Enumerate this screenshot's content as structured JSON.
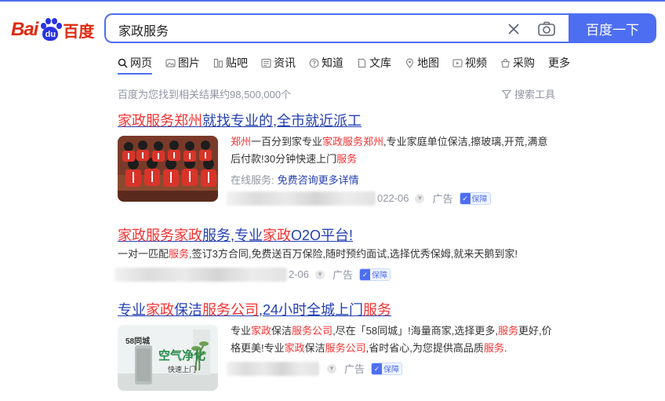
{
  "logo": {
    "latin": "Bai",
    "paw_text": "du",
    "cn": "百度"
  },
  "search": {
    "query": "家政服务",
    "button_label": "百度一下"
  },
  "tabs": [
    {
      "label": "网页",
      "icon": "search-icon"
    },
    {
      "label": "图片",
      "icon": "image-icon"
    },
    {
      "label": "贴吧",
      "icon": "tieba-icon"
    },
    {
      "label": "资讯",
      "icon": "news-icon"
    },
    {
      "label": "知道",
      "icon": "question-icon"
    },
    {
      "label": "文库",
      "icon": "document-icon"
    },
    {
      "label": "地图",
      "icon": "map-icon"
    },
    {
      "label": "视频",
      "icon": "video-icon"
    },
    {
      "label": "采购",
      "icon": "purchase-icon"
    },
    {
      "label": "更多",
      "icon": ""
    }
  ],
  "stats_text": "百度为您找到相关结果约98,500,000个",
  "tools_label": "搜索工具",
  "results": [
    {
      "title_parts": [
        {
          "t": "家政服务郑州",
          "hl": true
        },
        {
          "t": "就找专业的,全市就近派工",
          "hl": false
        }
      ],
      "desc_parts": [
        {
          "t": "郑州",
          "hl": true
        },
        {
          "t": "一百分到家专业",
          "hl": false
        },
        {
          "t": "家政服务郑州",
          "hl": true
        },
        {
          "t": ",专业家庭单位保洁,擦玻璃,开荒,满意后付款!30分钟快速上门",
          "hl": false
        },
        {
          "t": "服务",
          "hl": true
        }
      ],
      "service_label": "在线服务:",
      "service_link": "免费咨询更多详情",
      "date": "022-06",
      "ad_label": "广告",
      "badge": "保障"
    },
    {
      "title_parts": [
        {
          "t": "家政服务家政",
          "hl": true
        },
        {
          "t": "服务",
          "hl": false
        },
        {
          "t": ",专业",
          "hl": false
        },
        {
          "t": "家政",
          "hl": true
        },
        {
          "t": "O2O平台!",
          "hl": false
        }
      ],
      "desc_parts": [
        {
          "t": "一对一匹配",
          "hl": false
        },
        {
          "t": "服务",
          "hl": true
        },
        {
          "t": ",签订3方合同,免费送百万保险,随时预约面试,选择优秀保姆,就来天鹅到家!",
          "hl": false
        }
      ],
      "date": "2-06",
      "ad_label": "广告",
      "badge": "保障"
    },
    {
      "title_parts": [
        {
          "t": "专业",
          "hl": false
        },
        {
          "t": "家政",
          "hl": true
        },
        {
          "t": "保洁",
          "hl": false
        },
        {
          "t": "服务公司",
          "hl": true
        },
        {
          "t": ",24小时全城上门",
          "hl": false
        },
        {
          "t": "服务",
          "hl": true
        }
      ],
      "desc_parts": [
        {
          "t": "专业",
          "hl": false
        },
        {
          "t": "家政",
          "hl": true
        },
        {
          "t": "保洁",
          "hl": false
        },
        {
          "t": "服务公司",
          "hl": true
        },
        {
          "t": ",尽在「58同城」!海量商家,选择更多,",
          "hl": false
        },
        {
          "t": "服务",
          "hl": true
        },
        {
          "t": "更好,价格更美!专业",
          "hl": false
        },
        {
          "t": "家政",
          "hl": true
        },
        {
          "t": "保洁",
          "hl": false
        },
        {
          "t": "服务公司",
          "hl": true
        },
        {
          "t": ",省时省心,为您提供高品质",
          "hl": false
        },
        {
          "t": "服务",
          "hl": true
        },
        {
          "t": ".",
          "hl": false
        }
      ],
      "ad_label": "广告",
      "badge": "保障",
      "thumb": {
        "brand": "58同城",
        "headline": "空气净化",
        "sub": "快速上门"
      }
    }
  ],
  "colors": {
    "accent": "#4e6ef2",
    "link": "#2440b3",
    "highlight": "#f73131",
    "muted": "#9195a3"
  }
}
